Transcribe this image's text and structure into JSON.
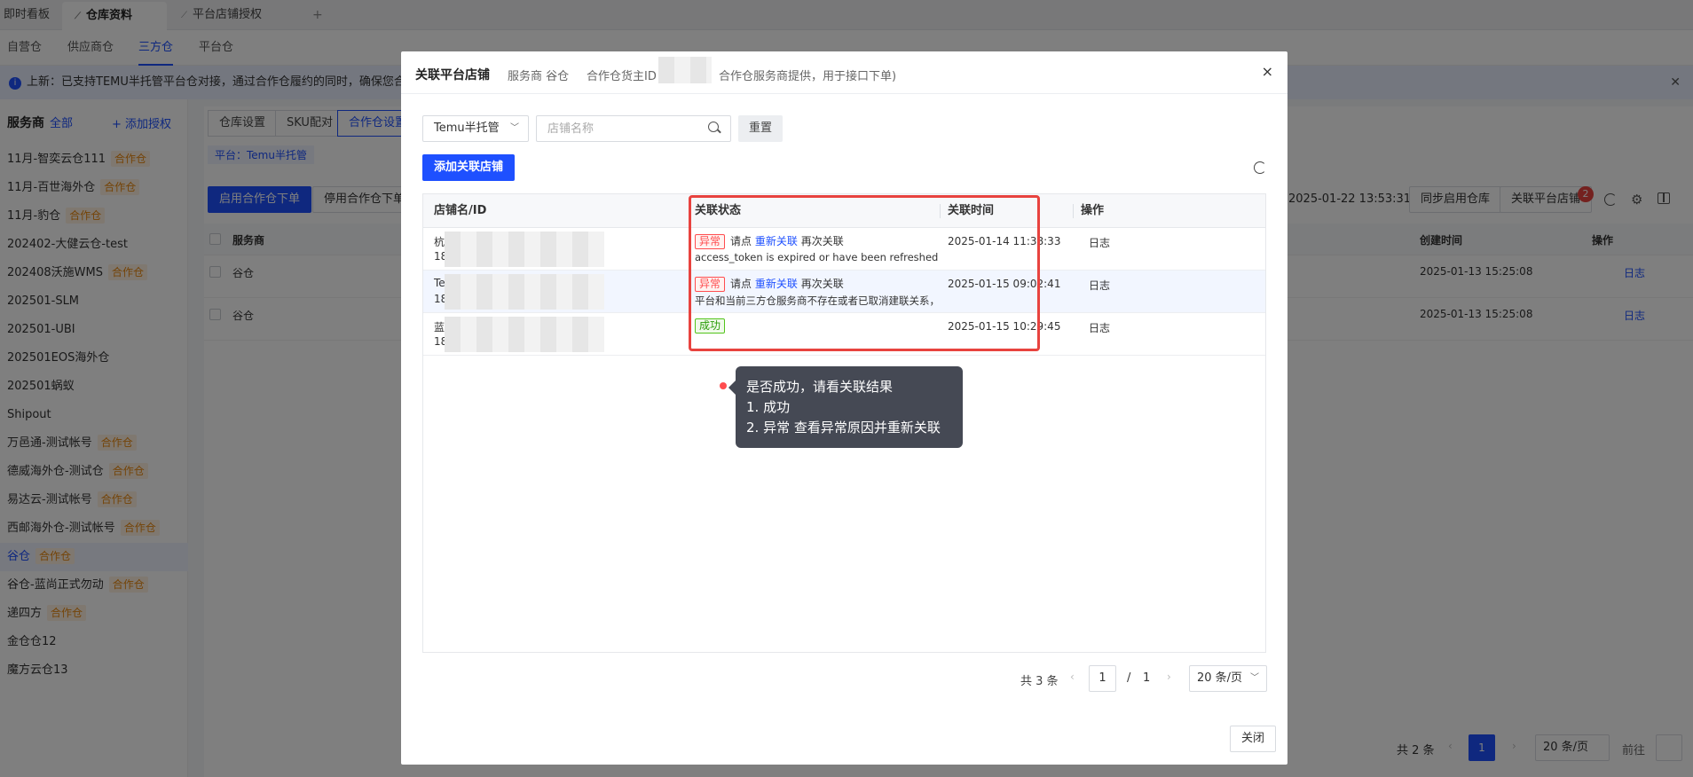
{
  "tabs": [
    {
      "label": "即时看板"
    },
    {
      "label": "仓库资料"
    },
    {
      "label": "平台店铺授权"
    }
  ],
  "tab_add": "+",
  "subnav": [
    "自营仓",
    "供应商仓",
    "三方仓",
    "平台仓"
  ],
  "notice": "上新：已支持TEMU半托管平台仓对接，通过合作仓履约的同时，确保您合作仓库的",
  "sidebar": {
    "title": "服务商",
    "all": "全部",
    "add": "+ 添加授权",
    "coop_tag": "合作仓",
    "items": [
      {
        "name": "11月-智奕云仓111",
        "coop": true
      },
      {
        "name": "11月-百世海外仓",
        "coop": true
      },
      {
        "name": "11月-豹仓",
        "coop": true
      },
      {
        "name": "202402-大健云仓-test",
        "coop": false
      },
      {
        "name": "202408沃施WMS",
        "coop": true
      },
      {
        "name": "202501-SLM",
        "coop": false
      },
      {
        "name": "202501-UBI",
        "coop": false
      },
      {
        "name": "202501EOS海外仓",
        "coop": false
      },
      {
        "name": "202501蜗蚁",
        "coop": false
      },
      {
        "name": "Shipout",
        "coop": false
      },
      {
        "name": "万邑通-测试帐号",
        "coop": true
      },
      {
        "name": "德威海外仓-测试仓",
        "coop": true
      },
      {
        "name": "易达云-测试帐号",
        "coop": true
      },
      {
        "name": "西邮海外仓-测试帐号",
        "coop": true
      },
      {
        "name": "谷仓",
        "coop": true
      },
      {
        "name": "谷仓-蓝尚正式勿动",
        "coop": true
      },
      {
        "name": "递四方",
        "coop": true
      },
      {
        "name": "金仓仓12",
        "coop": false
      },
      {
        "name": "魔方云仓13",
        "coop": false
      }
    ]
  },
  "main": {
    "tabs": [
      "仓库设置",
      "SKU配对",
      "合作仓设置"
    ],
    "platform": "平台：Temu半托管",
    "enable_btn": "启用合作仓下单",
    "disable_btn": "停用合作仓下单",
    "time_text": "2025-01-22 13:53:31",
    "sync_btn": "同步启用仓库",
    "link_btn": "关联平台店铺",
    "link_badge": "2",
    "col_vendor": "服务商",
    "col_created": "创建时间",
    "col_action": "操作",
    "rows": [
      {
        "vendor": "谷仓",
        "created": "2025-01-13 15:25:08",
        "action": "日志"
      },
      {
        "vendor": "谷仓",
        "created": "2025-01-13 15:25:08",
        "action": "日志"
      }
    ],
    "pager_total": "共 2 条",
    "pager_page": "1",
    "pager_size": "20 条/页",
    "pager_goto": "前往"
  },
  "modal": {
    "title": "关联平台店铺",
    "provider_label": "服务商 谷仓",
    "owner_label": "合作仓货主ID",
    "owner_tail": "合作仓服务商提供，用于接口下单)",
    "close_icon": "×",
    "platform_select": "Temu半托管",
    "search_placeholder": "店铺名称",
    "reset": "重置",
    "add_shop": "添加关联店铺",
    "columns": {
      "shop": "店铺名/ID",
      "status": "关联状态",
      "time": "关联时间",
      "action": "操作"
    },
    "rows": [
      {
        "shop_name": "杭",
        "shop_id": "18",
        "status_tag": "异常",
        "status_prefix": "请点",
        "status_link": "重新关联",
        "status_suffix": "再次关联",
        "status_msg": "access_token is expired or have been refreshed, please contact ...",
        "time": "2025-01-14 11:38:33",
        "action": "日志"
      },
      {
        "shop_name": "Te",
        "shop_id": "18",
        "status_tag": "异常",
        "status_prefix": "请点",
        "status_link": "重新关联",
        "status_suffix": "再次关联",
        "status_msg": "平台和当前三方仓服务商不存在或者已取消建联关系，请与平台沟通",
        "time": "2025-01-15 09:02:41",
        "action": "日志"
      },
      {
        "shop_name": "蓝",
        "shop_id": "18",
        "status_tag": "成功",
        "time": "2025-01-15 10:29:45",
        "action": "日志"
      }
    ],
    "tooltip": [
      "是否成功，请看关联结果",
      "1. 成功",
      "2. 异常 查看异常原因并重新关联"
    ],
    "pager_total": "共 3 条",
    "pager_page": "1",
    "pager_sep": "/",
    "pager_pages": "1",
    "pager_size": "20 条/页",
    "close": "关闭"
  },
  "colors": {
    "accent": "#1e50ff",
    "error": "#ff4d4f",
    "success": "#52c41a",
    "highlight_box": "#e8433f"
  }
}
